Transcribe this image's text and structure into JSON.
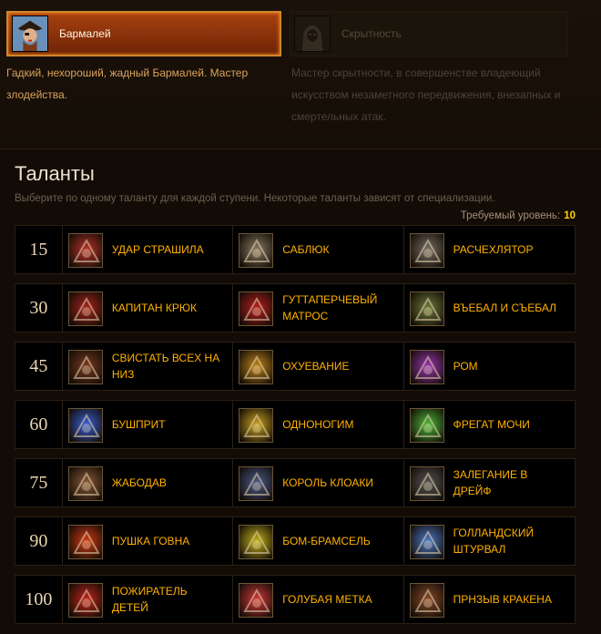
{
  "specs": [
    {
      "name": "Бармалей",
      "description": "Гадкий, нехороший, жадный Бармалей. Мастер злодейства.",
      "icon": "pirate-icon",
      "active": true
    },
    {
      "name": "Скрытность",
      "description": "Мастер скрытности, в совершенстве владеющий искусством незаметного передвижения, внезапных и смертельных атак.",
      "icon": "hooded-figure-icon",
      "active": false
    }
  ],
  "talents_section": {
    "title": "Таланты",
    "subtitle": "Выберите по одному таланту для каждой ступени. Некоторые таланты зависят от специализации.",
    "required_level_label": "Требуемый уровень:",
    "required_level_value": "10"
  },
  "tiers": [
    {
      "level": "15",
      "talents": [
        {
          "name": "Удар страшила",
          "icon": "skull-crossbones-icon",
          "color": "#b8342a"
        },
        {
          "name": "Саблюк",
          "icon": "cutlass-icon",
          "color": "#8a7a62"
        },
        {
          "name": "Расчехлятор",
          "icon": "flintlock-pistol-icon",
          "color": "#7a7066"
        }
      ]
    },
    {
      "level": "30",
      "talents": [
        {
          "name": "Капитан крюк",
          "icon": "hook-icon",
          "color": "#a8231c"
        },
        {
          "name": "Гуттаперчевый матрос",
          "icon": "acrobat-sailor-icon",
          "color": "#b91f1f"
        },
        {
          "name": "Въебал и съебал",
          "icon": "strike-and-run-icon",
          "color": "#6e7a3a"
        }
      ]
    },
    {
      "level": "45",
      "talents": [
        {
          "name": "Свистать всех на низ",
          "icon": "crew-whistle-icon",
          "color": "#7a3b22"
        },
        {
          "name": "Охуевание",
          "icon": "stun-icon",
          "color": "#c2861c"
        },
        {
          "name": "Ром",
          "icon": "rum-icon",
          "color": "#9a36b0"
        }
      ]
    },
    {
      "level": "60",
      "talents": [
        {
          "name": "Бушприт",
          "icon": "bowsprit-icon",
          "color": "#3a5fd1"
        },
        {
          "name": "Одноногим",
          "icon": "peg-leg-icon",
          "color": "#c9a21e"
        },
        {
          "name": "Фрегат мочи",
          "icon": "frigate-icon",
          "color": "#4fb83a"
        }
      ]
    },
    {
      "level": "75",
      "talents": [
        {
          "name": "Жабодав",
          "icon": "toad-crusher-icon",
          "color": "#8a5a36"
        },
        {
          "name": "Король клоаки",
          "icon": "sewer-king-icon",
          "color": "#4a5a8a"
        },
        {
          "name": "Залегание в дрейф",
          "icon": "drift-icon",
          "color": "#555555"
        }
      ]
    },
    {
      "level": "90",
      "talents": [
        {
          "name": "Пушка говна",
          "icon": "cannon-icon",
          "color": "#d23a14"
        },
        {
          "name": "Бом-брамсель",
          "icon": "sail-icon",
          "color": "#c4b21c"
        },
        {
          "name": "Голландский штурвал",
          "icon": "helm-wheel-icon",
          "color": "#4a78c8"
        }
      ]
    },
    {
      "level": "100",
      "talents": [
        {
          "name": "Пожиратель детей",
          "icon": "devourer-icon",
          "color": "#c2241c"
        },
        {
          "name": "Голубая метка",
          "icon": "black-spot-skull-icon",
          "color": "#d23a3a"
        },
        {
          "name": "Прнзыв кракена",
          "icon": "kraken-summon-icon",
          "color": "#8a4a2a"
        }
      ]
    }
  ]
}
